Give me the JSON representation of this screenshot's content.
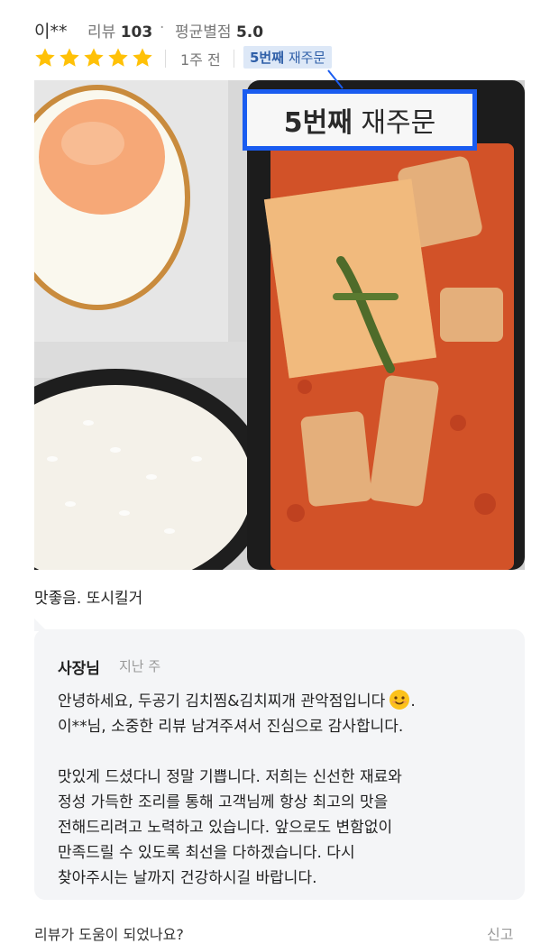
{
  "header": {
    "username": "이**",
    "review_label": "리뷰",
    "review_count": "103",
    "separator": "·",
    "avg_label": "평균별점",
    "avg_value": "5.0"
  },
  "rating": {
    "stars": 5,
    "max": 5,
    "color": "#ffc107"
  },
  "meta": {
    "ago": "1주 전",
    "reorder_count": "5번째",
    "reorder_word": "재주문"
  },
  "photo": {
    "alt": "",
    "callout_count": "5번째",
    "callout_word": "재주문"
  },
  "review_text": "맛좋음. 또시킬거",
  "reply": {
    "owner": "사장님",
    "ago": "지난 주",
    "line1": "안녕하세요, 두공기 김치찜&김치찌개 관악점입니다",
    "line1_end": ".",
    "line2": "이**님, 소중한 리뷰 남겨주셔서 진심으로 감사합니다.",
    "para2": [
      "맛있게 드셨다니 정말 기쁩니다. 저희는 신선한 재료와",
      "정성 가득한 조리를 통해 고객님께 항상 최고의 맛을",
      "전해드리려고 노력하고 있습니다. 앞으로도 변함없이",
      "만족드릴 수 있도록 최선을 다하겠습니다. 다시",
      "찾아주시는 날까지 건강하시길 바랍니다."
    ]
  },
  "footer": {
    "helpful": "리뷰가 도움이 되었나요?",
    "report": "신고"
  },
  "colors": {
    "accent_blue": "#1a5cf0",
    "tag_bg": "#dde8f7",
    "tag_text": "#2f5fa8"
  }
}
